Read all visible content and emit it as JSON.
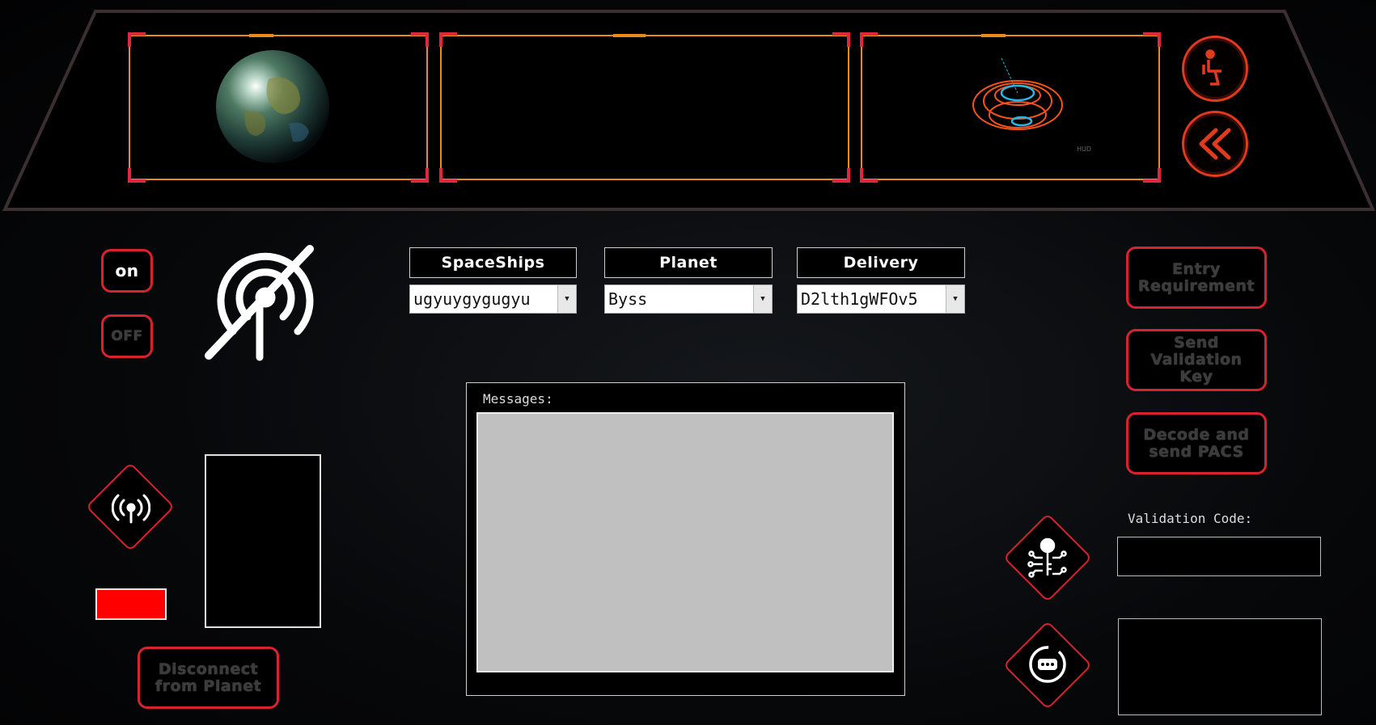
{
  "power": {
    "on_label": "on",
    "off_label": "OFF"
  },
  "top_right": {
    "seat_icon": "seat-icon",
    "back_icon": "double-chevron-left-icon"
  },
  "selectors": {
    "spaceships": {
      "header": "SpaceShips",
      "value": "ugyuygygugyu"
    },
    "planet": {
      "header": "Planet",
      "value": "Byss"
    },
    "delivery": {
      "header": "Delivery",
      "value": "D2lth1gWFOv5"
    }
  },
  "messages": {
    "label": "Messages:",
    "content": ""
  },
  "actions": {
    "entry_requirement": "Entry Requirement",
    "send_validation_key": "Send Validation Key",
    "decode_send_pacs": "Decode and send PACS",
    "disconnect": "Disconnect from Planet"
  },
  "validation": {
    "label": "Validation Code:",
    "value": ""
  },
  "hud_label": "HUD",
  "colors": {
    "accent_red": "#d8232f",
    "frame_orange": "#e98a1a",
    "status_red": "#ff0000"
  }
}
